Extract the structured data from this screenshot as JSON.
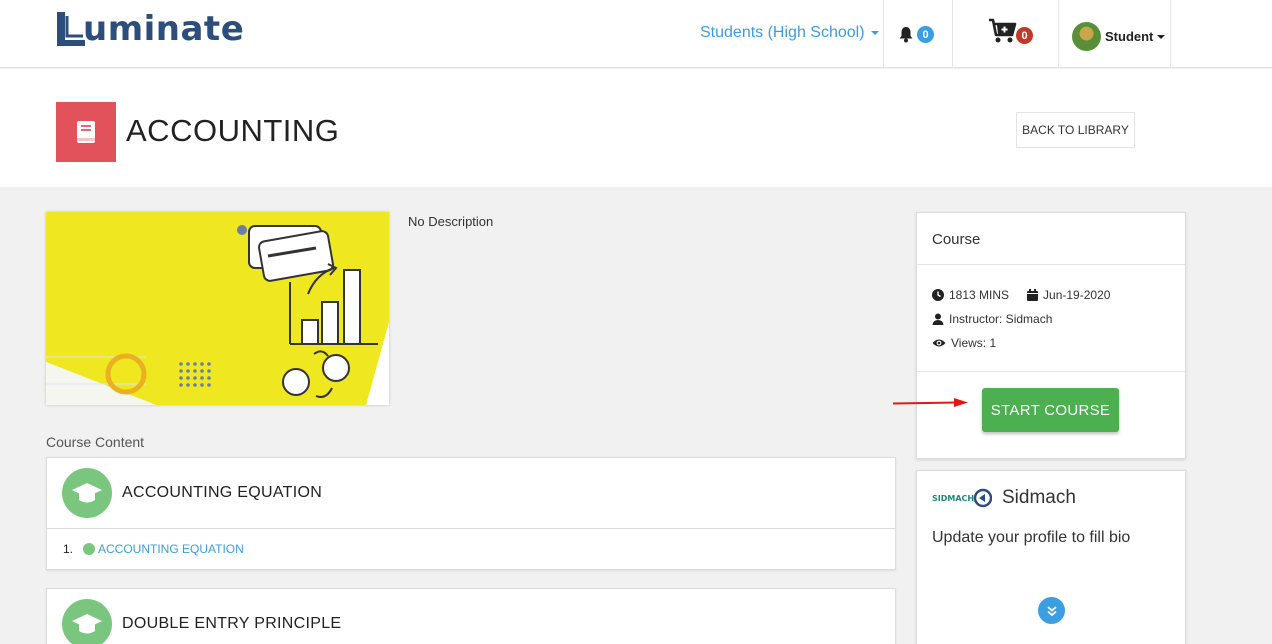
{
  "app": {
    "logo_text": "uminate"
  },
  "header": {
    "role_label": "Students (High School)",
    "notifications_count": "0",
    "cart_count": "0",
    "user_label": "Student"
  },
  "page": {
    "title": "ACCOUNTING",
    "back_label": "BACK TO LIBRARY",
    "description": "No Description",
    "course_content_label": "Course Content"
  },
  "modules": [
    {
      "title": "ACCOUNTING EQUATION",
      "lessons": [
        {
          "number": "1.",
          "title": "ACCOUNTING EQUATION"
        }
      ]
    },
    {
      "title": "DOUBLE ENTRY PRINCIPLE"
    }
  ],
  "course_card": {
    "heading": "Course",
    "duration": "1813 MINS",
    "date": "Jun-19-2020",
    "instructor": "Instructor: Sidmach",
    "views": "Views: 1",
    "start_label": "START COURSE"
  },
  "bio_card": {
    "name": "Sidmach",
    "bio": "Update your profile to fill bio"
  },
  "colors": {
    "accent_blue": "#3a9ee0",
    "title_icon_red": "#e2525b",
    "start_green": "#4caf50",
    "module_green": "#7bc67e",
    "brand_navy": "#2d4d7a"
  },
  "icons": [
    "bell-icon",
    "cart-icon",
    "book-icon",
    "clock-icon",
    "calendar-icon",
    "user-icon",
    "eye-icon",
    "graduation-cap-icon",
    "chevron-double-down-icon"
  ]
}
